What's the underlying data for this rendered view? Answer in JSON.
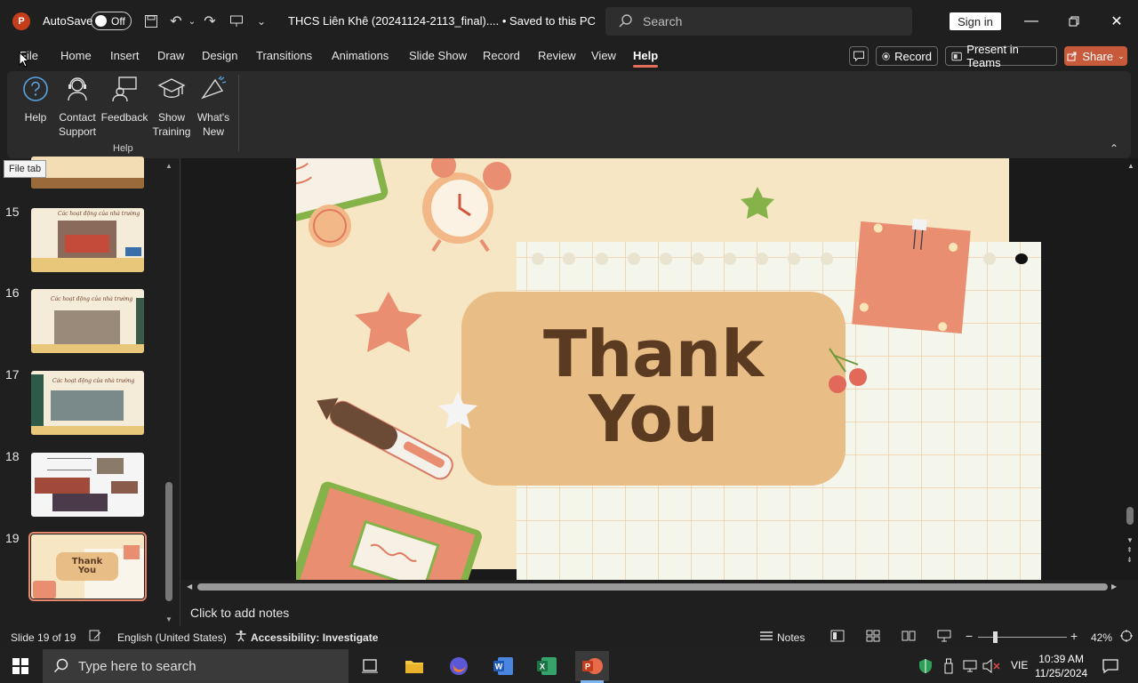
{
  "titlebar": {
    "app_logo": "P",
    "autosave_label": "AutoSave",
    "autosave_state": "Off",
    "document_title": "THCS Liên Khê (20241124-2113_final)....  •  Saved to this PC",
    "search_placeholder": "Search",
    "signin_label": "Sign in",
    "icons": [
      "save-icon",
      "undo-icon",
      "redo-icon",
      "present-icon",
      "customize-icon"
    ]
  },
  "tabs": [
    "File",
    "Home",
    "Insert",
    "Draw",
    "Design",
    "Transitions",
    "Animations",
    "Slide Show",
    "Record",
    "Review",
    "View",
    "Help"
  ],
  "tab_actions": {
    "comments_icon": "comment-icon",
    "record_label": "Record",
    "teams_label": "Present in Teams",
    "share_label": "Share"
  },
  "ribbon": {
    "group_label": "Help",
    "items": [
      {
        "label": "Help",
        "icon": "help-icon"
      },
      {
        "label": "Contact Support",
        "icon": "support-icon"
      },
      {
        "label": "Feedback",
        "icon": "feedback-icon"
      },
      {
        "label": "Show Training",
        "icon": "training-icon"
      },
      {
        "label": "What's New",
        "icon": "whats-new-icon"
      }
    ]
  },
  "tooltip": "File tab",
  "thumbnails": {
    "numbers": [
      "15",
      "16",
      "17",
      "18",
      "19"
    ],
    "titles": [
      "Các hoạt động của nhà trường",
      "Các hoạt động của nhà trường",
      "Các hoạt động của nhà trường",
      "",
      "Thank You"
    ],
    "selected": "19"
  },
  "slide": {
    "line1": "Thank",
    "line2": "You"
  },
  "notes_placeholder": "Click to add notes",
  "status": {
    "slide_info": "Slide 19 of 19",
    "language": "English (United States)",
    "accessibility": "Accessibility: Investigate",
    "notes_label": "Notes",
    "zoom": "42%"
  },
  "taskbar": {
    "search_placeholder": "Type here to search",
    "language": "VIE",
    "time": "10:39 AM",
    "date": "11/25/2024"
  },
  "colors": {
    "accent": "#e56e5a",
    "slide_bg": "#f6e6c4",
    "thank_you_box": "#e9bd86",
    "text_brown": "#5a3b22",
    "sticky_note": "#e98e70"
  }
}
